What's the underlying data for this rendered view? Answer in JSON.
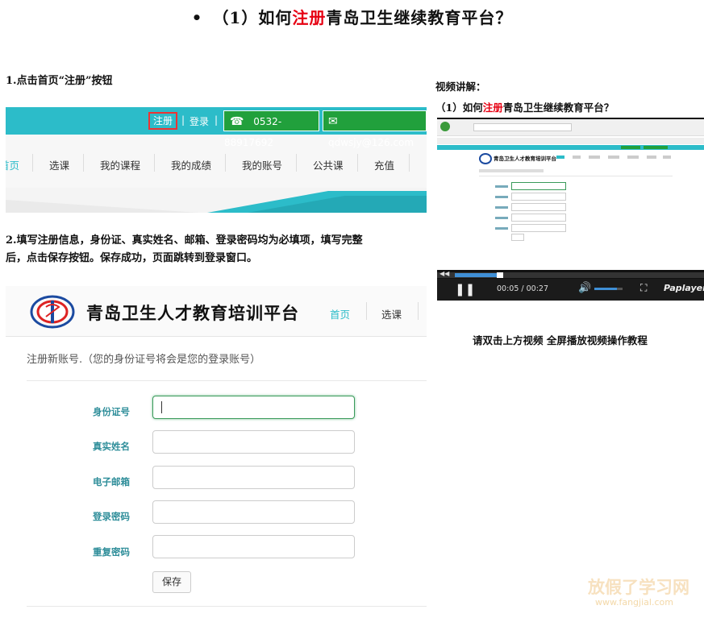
{
  "title": {
    "bullet": "•",
    "prefix": "（1）如何",
    "highlight": "注册",
    "suffix": "青岛卫生继续教育平台？"
  },
  "step1": {
    "text": "1.点击首页“注册”按钮"
  },
  "screenshot1": {
    "register": "注册",
    "login": "登录",
    "sep": "|",
    "phone": "0532-88917692",
    "email": "qdwsjy@126.com",
    "nav": [
      "首页",
      "选课",
      "我的课程",
      "我的成绩",
      "我的账号",
      "公共课",
      "充值"
    ]
  },
  "step2": {
    "line1": "2.填写注册信息，身份证、真实姓名、邮箱、登录密码均为必填项，填写完整",
    "line2": "后，点击保存按钮。保存成功，页面跳转到登录窗口。"
  },
  "screenshot2": {
    "platform_name": "青岛卫生人才教育培训平台",
    "nav_home": "首页",
    "nav_courses": "选课",
    "hint": "注册新账号.（您的身份证号将会是您的登录账号）",
    "fields": [
      "身份证号",
      "真实姓名",
      "电子邮箱",
      "登录密码",
      "重复密码"
    ],
    "save": "保存"
  },
  "video_section": {
    "heading": "视频讲解：",
    "subtitle_prefix": "（1）如何",
    "subtitle_highlight": "注册",
    "subtitle_suffix": "青岛卫生继续教育平台？",
    "video_header": "青岛卫生人才教育培训平台",
    "time": "00:05 / 00:27",
    "progress": 0.185,
    "volume": 0.8,
    "player_brand": "Paplayer",
    "caption": "请双击上方视频 全屏播放视频操作教程"
  },
  "watermark": {
    "text": "放假了学习网",
    "url": "www.fangjial.com"
  },
  "colors": {
    "accent_red": "#e60012",
    "teal": "#2cbcc9",
    "green": "#21a03c",
    "label_teal": "#2f8e9a"
  }
}
